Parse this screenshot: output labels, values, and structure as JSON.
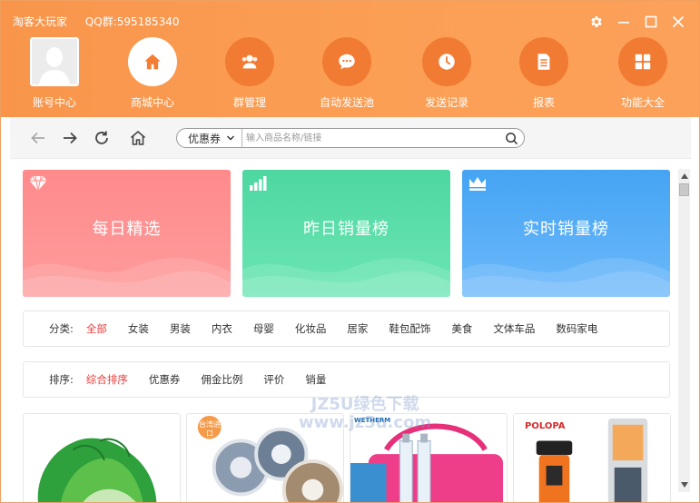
{
  "window": {
    "app_name": "淘客大玩家",
    "qq_group": "QQ群:595185340"
  },
  "nav": [
    {
      "label": "账号中心",
      "icon": "avatar"
    },
    {
      "label": "商城中心",
      "icon": "home-icon",
      "active": true
    },
    {
      "label": "群管理",
      "icon": "users-icon"
    },
    {
      "label": "自动发送池",
      "icon": "chat-icon"
    },
    {
      "label": "发送记录",
      "icon": "clock-icon"
    },
    {
      "label": "报表",
      "icon": "document-icon"
    },
    {
      "label": "功能大全",
      "icon": "grid-icon"
    }
  ],
  "toolbar": {
    "search_type": "优惠券",
    "search_placeholder": "输入商品名称/链接"
  },
  "cards": [
    {
      "title": "每日精选",
      "icon": "diamond-icon",
      "color": "#ff8a8c"
    },
    {
      "title": "昨日销量榜",
      "icon": "bar-chart-icon",
      "color": "#4ed7a1"
    },
    {
      "title": "实时销量榜",
      "icon": "crown-icon",
      "color": "#45a4f3"
    }
  ],
  "category": {
    "label": "分类:",
    "items": [
      "全部",
      "女装",
      "男装",
      "内衣",
      "母婴",
      "化妆品",
      "居家",
      "鞋包配饰",
      "美食",
      "文体车品",
      "数码家电"
    ]
  },
  "sort": {
    "label": "排序:",
    "items": [
      "综合排序",
      "优惠券",
      "佣金比例",
      "评价",
      "销量"
    ]
  },
  "products": {
    "badge_taiwan": "台湾进口",
    "brand_wetherm": "WETHERM",
    "brand_polopa": "POLOPA"
  },
  "watermark": {
    "line1": "JZ5U绿色下载",
    "line2": "www.jz5u.com"
  },
  "colors": {
    "header": "#fb9f55",
    "accent_active": "#e83c3c"
  }
}
